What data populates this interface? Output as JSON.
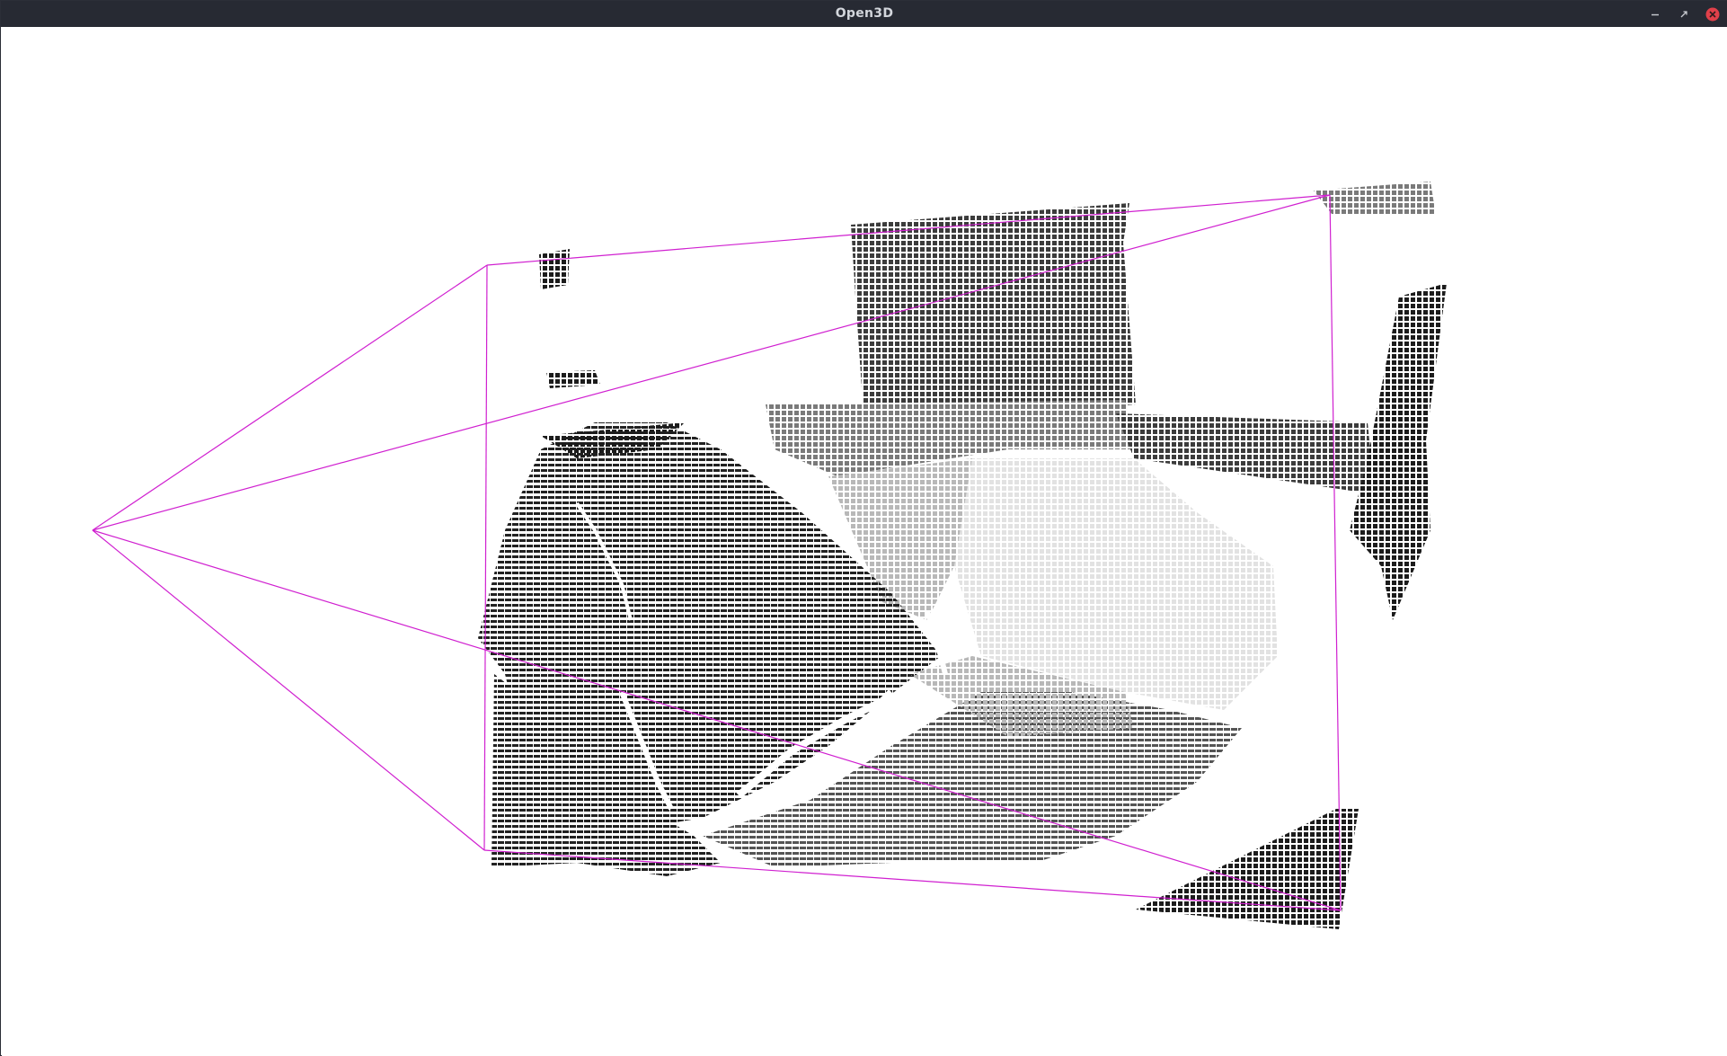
{
  "window": {
    "title": "Open3D",
    "controls": [
      {
        "name": "minimize",
        "icon": "minimize-icon"
      },
      {
        "name": "maximize",
        "icon": "maximize-icon"
      },
      {
        "name": "close",
        "icon": "close-icon"
      }
    ]
  },
  "viewport": {
    "background": "#ffffff",
    "point_color_dark": "#1a1a1a",
    "point_color_light": "#f2f2f2",
    "frustum_color": "#d020d0",
    "content": "point-cloud-with-camera-frustum"
  },
  "colors": {
    "titlebar_bg": "#272a33",
    "title_text": "#d3d6dc",
    "close_button": "#e0404a"
  }
}
